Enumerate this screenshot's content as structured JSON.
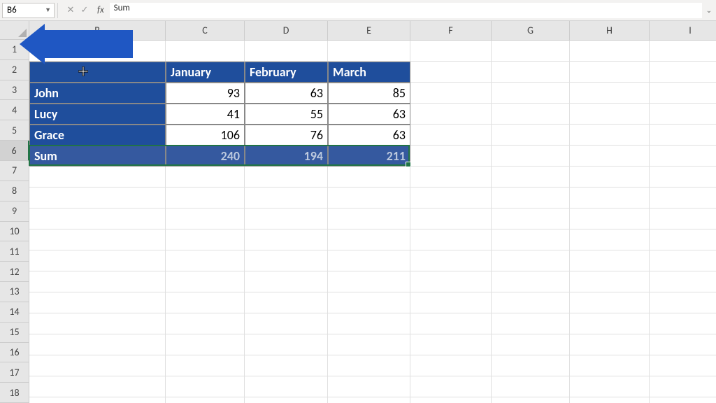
{
  "formula_bar": {
    "cell_ref": "B6",
    "cancel": "✕",
    "confirm": "✓",
    "fx": "fx",
    "formula_value": "Sum"
  },
  "columns": [
    "B",
    "C",
    "D",
    "E",
    "F",
    "G",
    "H",
    "I"
  ],
  "col_widths": {
    "B": 195,
    "C": 113,
    "D": 119,
    "E": 118,
    "F": 116,
    "G": 112,
    "H": 114,
    "I": 117
  },
  "row_labels": [
    "1",
    "2",
    "3",
    "4",
    "5",
    "6",
    "7",
    "8",
    "9",
    "10",
    "11",
    "12",
    "13",
    "14",
    "15",
    "16",
    "17",
    "18"
  ],
  "selected_row": 6,
  "table": {
    "months": [
      "January",
      "February",
      "March"
    ],
    "rows": [
      {
        "name": "John",
        "vals": [
          93,
          63,
          85
        ]
      },
      {
        "name": "Lucy",
        "vals": [
          41,
          55,
          63
        ]
      },
      {
        "name": "Grace",
        "vals": [
          106,
          76,
          63
        ]
      }
    ],
    "sum_label": "Sum",
    "sums": [
      240,
      194,
      211
    ]
  },
  "chart_data": {
    "type": "table",
    "columns": [
      "",
      "January",
      "February",
      "March"
    ],
    "rows": [
      [
        "John",
        93,
        63,
        85
      ],
      [
        "Lucy",
        41,
        55,
        63
      ],
      [
        "Grace",
        106,
        76,
        63
      ],
      [
        "Sum",
        240,
        194,
        211
      ]
    ]
  }
}
